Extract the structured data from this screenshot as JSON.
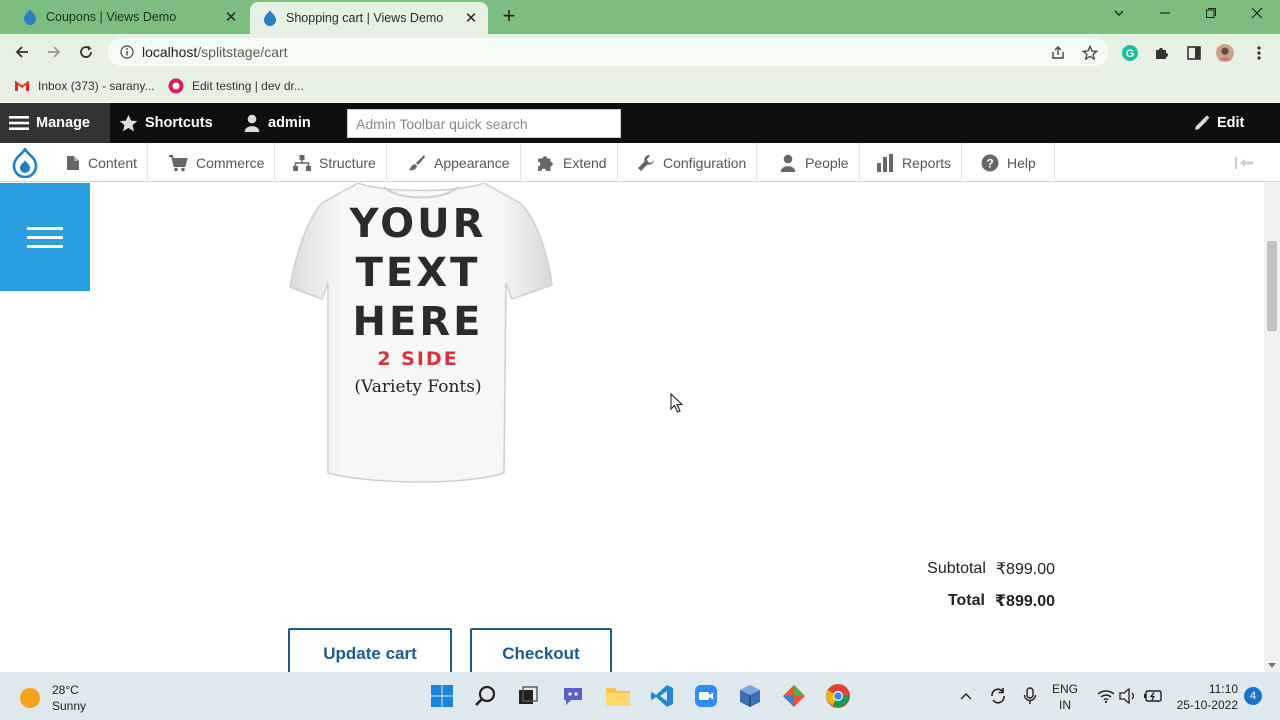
{
  "browser": {
    "tabs": [
      {
        "title": "Coupons | Views Demo",
        "active": false
      },
      {
        "title": "Shopping cart | Views Demo",
        "active": true
      }
    ],
    "url_host": "localhost",
    "url_path": "/splitstage/cart",
    "bookmarks": [
      {
        "label": "Inbox (373) - sarany...",
        "icon": "gmail-icon"
      },
      {
        "label": "Edit testing | dev dr...",
        "icon": "app-icon"
      }
    ],
    "accent": "#7dbd7f"
  },
  "admin_toolbar": {
    "manage": "Manage",
    "shortcuts": "Shortcuts",
    "user": "admin",
    "search_placeholder": "Admin Toolbar quick search",
    "edit": "Edit"
  },
  "admin_tray": {
    "items": [
      "Content",
      "Commerce",
      "Structure",
      "Appearance",
      "Extend",
      "Configuration",
      "People",
      "Reports",
      "Help"
    ]
  },
  "product": {
    "shirt_text_1": "YOUR",
    "shirt_text_2": "TEXT",
    "shirt_text_3": "HERE",
    "shirt_text_4": "2 SIDE",
    "shirt_text_5": "(Variety Fonts)"
  },
  "cart": {
    "subtotal_label": "Subtotal",
    "subtotal_value": "₹899.00",
    "total_label": "Total",
    "total_value": "₹899.00",
    "update_button": "Update cart",
    "checkout_button": "Checkout"
  },
  "taskbar": {
    "temperature": "28°C",
    "weather": "Sunny",
    "lang_1": "ENG",
    "lang_2": "IN",
    "time": "11:10",
    "date": "25-10-2022",
    "notifications": "4"
  }
}
